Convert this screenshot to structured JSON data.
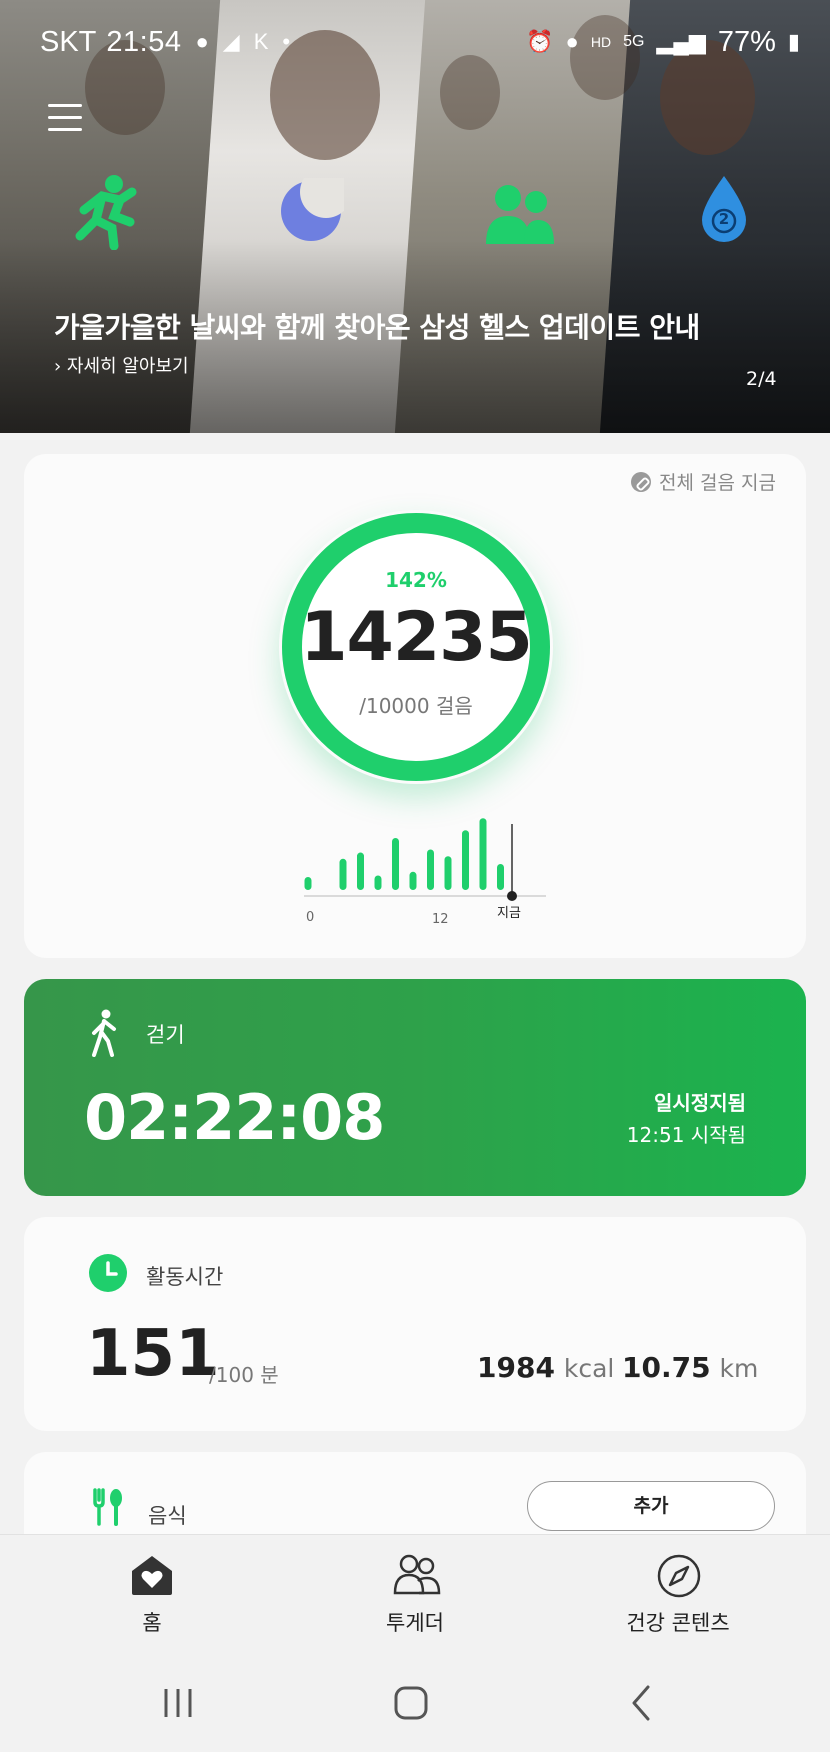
{
  "status_bar": {
    "carrier": "SKT",
    "time": "21:54",
    "network": "5G",
    "battery": "77%"
  },
  "hero": {
    "title": "가을가을한 날씨와 함께 찾아온 삼성 헬스 업데이트 안내",
    "link": "› 자세히 알아보기",
    "page_indicator": "2/4",
    "drop_number": "2"
  },
  "steps_card": {
    "all_steps_link": "전체 걸음 지금",
    "percent": "142%",
    "steps": "14235",
    "goal": "/10000 걸음",
    "chart": {
      "x_labels": [
        "0",
        "12",
        "지금"
      ]
    }
  },
  "chart_data": {
    "type": "bar",
    "values": [
      0.25,
      0,
      0.6,
      0.72,
      0.28,
      1.0,
      0.35,
      0.78,
      0.65,
      1.15,
      1.38,
      0.5
    ],
    "x_tick_labels": [
      "0",
      "12",
      "지금"
    ],
    "title": ""
  },
  "walk_card": {
    "label": "걷기",
    "duration": "02:22:08",
    "status": "일시정지됨",
    "started": "12:51 시작됨"
  },
  "active_card": {
    "label": "활동시간",
    "value": "151",
    "goal": "/100 분",
    "kcal_value": "1984",
    "kcal_unit": "kcal",
    "km_value": "10.75",
    "km_unit": "km"
  },
  "food_card": {
    "label": "음식",
    "add_button": "추가"
  },
  "bottom_nav": {
    "home": "홈",
    "together": "투게더",
    "content": "건강 콘텐츠"
  },
  "colors": {
    "accent": "#1fcf6c",
    "walk_card": "#2ea14a"
  }
}
